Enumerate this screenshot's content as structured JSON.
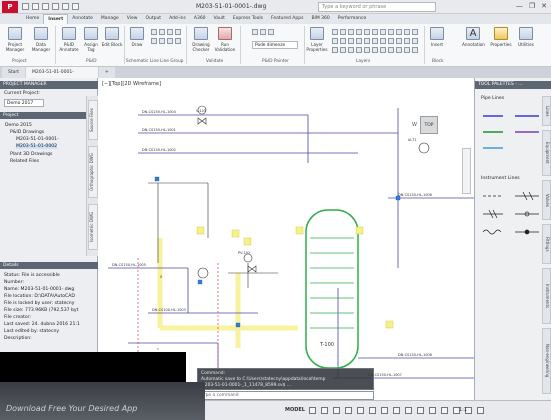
{
  "title_bar": {
    "app_button": "P",
    "doc_title": "M203-51-01-0001-.dwg",
    "search_placeholder": "Type a keyword or phrase",
    "controls": [
      "—",
      "❐",
      "✕"
    ]
  },
  "ribbon_tabs": [
    "Home",
    "Insert",
    "Annotate",
    "Manage",
    "View",
    "Output",
    "Add-ins",
    "A360",
    "Vault",
    "Express Tools",
    "Featured Apps",
    "BIM 360",
    "Performance"
  ],
  "active_tab": "Home",
  "ribbon": {
    "buttons": [
      {
        "label": "Project Manager",
        "name": "project-manager-button"
      },
      {
        "label": "Data Manager",
        "name": "data-manager-button"
      },
      {
        "label": "P&ID Annotate",
        "name": "pid-annotate-button"
      },
      {
        "label": "Assign Tag",
        "name": "assign-tag-button"
      },
      {
        "label": "Edit Block",
        "name": "edit-block-button"
      },
      {
        "label": "Draw",
        "name": "draw-button"
      },
      {
        "label": "Drawing Checker",
        "name": "drawing-checker-button"
      },
      {
        "label": "Run Validation",
        "name": "run-validation-button"
      },
      {
        "label": "Layer Properties",
        "name": "layer-properties-button"
      },
      {
        "label": "Insert",
        "name": "insert-button"
      },
      {
        "label": "Annotation",
        "name": "annotation-button"
      },
      {
        "label": "Properties",
        "name": "properties-button"
      },
      {
        "label": "Utilities",
        "name": "utilities-button"
      }
    ],
    "groups": [
      "Project",
      "P&ID",
      "Schematic Line",
      "Line Group",
      "Validate",
      "P&ID Painter",
      "Layers",
      "Block"
    ],
    "painter_dropdown": "Pode dimenze"
  },
  "doc_tabs": [
    "Start",
    "M203-51-01-0001-",
    "+"
  ],
  "viewport_label": "[−][Top][2D Wireframe]",
  "left_panel": {
    "title": "PROJECT MANAGER",
    "current_project_label": "Current Project:",
    "current_project": "Demo 2017",
    "project_section": "Project",
    "tree": [
      "Demo 2015",
      "P&ID Drawings",
      "M203-51-01-0001-",
      "M203-51-01-0002",
      "Plant 3D Drawings",
      "Related Files"
    ],
    "side_tabs": [
      "Source Files",
      "Orthographic DWG",
      "Isometric DWG"
    ],
    "details_title": "Details",
    "details": [
      "Status: File is accessible",
      "Number:",
      "Name: M203-51-01-0001-.dwg",
      "File location: D:\\DATA\\AutoCAD",
      "File is locked by user: statecny",
      "File size: 773.96KB (792,537 byt",
      "File creator:",
      "Last saved: 24. dubna 2016 21:1",
      "Last edited by: statecny",
      "Description:"
    ]
  },
  "right_panel": {
    "title": "TOOL PALETTES - ...",
    "sections": [
      "Pipe Lines",
      "Instrument Lines"
    ],
    "side_tabs": [
      "Lines",
      "Equipment",
      "Valves",
      "Fittings",
      "Instruments",
      "Non-engineering"
    ]
  },
  "viewcube": {
    "face": "TOP",
    "compass": "W"
  },
  "diagram_labels": {
    "vessel": "T-100",
    "lines": [
      "DN-CS150-HL-1004",
      "DN-CS150-HL-1001",
      "DN-CS150-HL-1002",
      "DN-CS150-HL-1005",
      "DN-CS100-HL-1003",
      "DN-CS150-HL-1007",
      "DN-CS150-HL-1006",
      "DN-CS150-HL-1008"
    ],
    "tags": [
      "IA-T1",
      "PV-102",
      "S",
      "V-101"
    ]
  },
  "command": {
    "lines": [
      "Command:",
      "Automatic save to C:\\Users\\statecny\\appdata\\local\\temp",
      "M203-51-01-0001-_1_11478_8599.sv$ ..."
    ],
    "prompt": "Type a command"
  },
  "watermark": "Download Free Your Desired App",
  "status_bar": {
    "model": "MODEL",
    "zoom": "1:1"
  },
  "colors": {
    "pipe": "#4a4aa8",
    "vessel": "#2fae4a",
    "highlight": "#f6f08a",
    "title": "#c8102e"
  }
}
